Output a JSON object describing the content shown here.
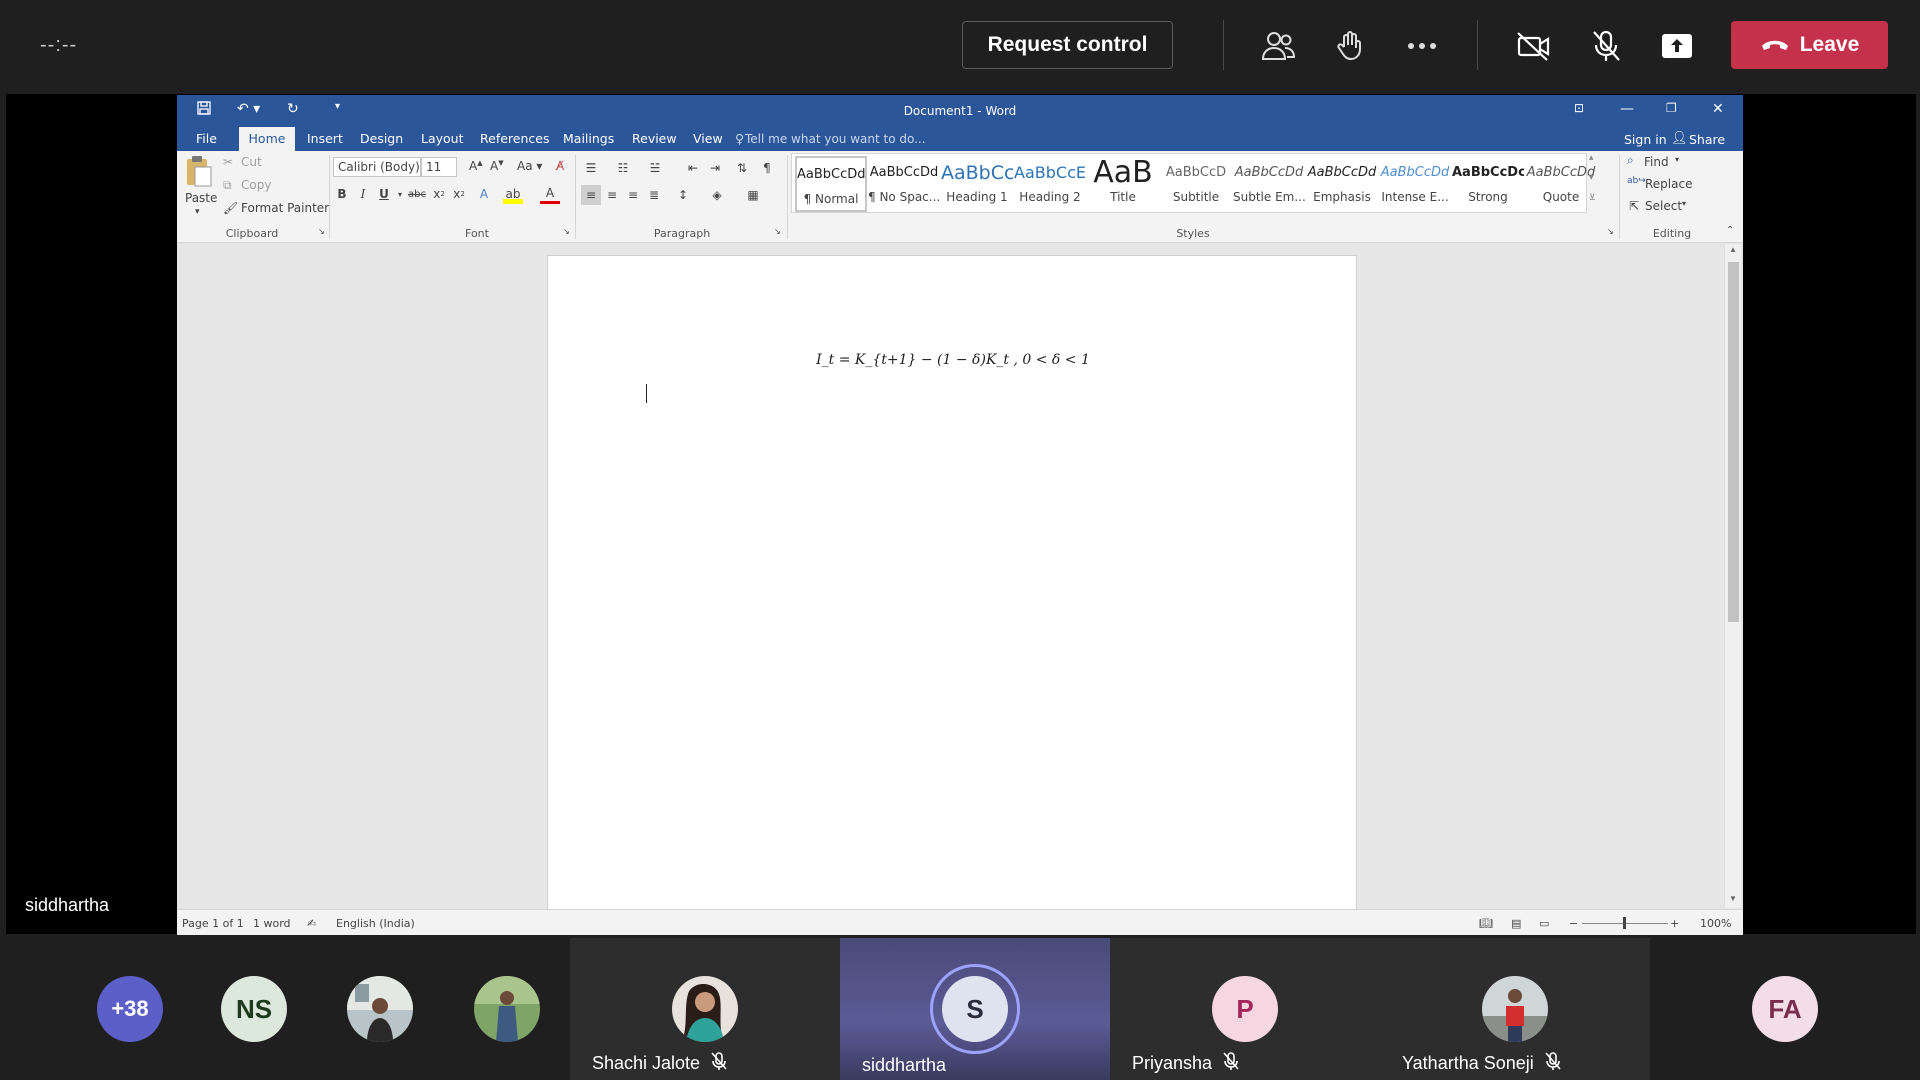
{
  "meeting": {
    "timer": "--:--",
    "request_control": "Request control",
    "leave": "Leave",
    "presenter_name": "siddhartha",
    "icons": [
      "people-icon",
      "raise-hand-icon",
      "more-options-icon",
      "camera-off-icon",
      "mic-off-icon",
      "share-screen-icon",
      "phone-hangup-icon"
    ],
    "leave_color": "#c4314b"
  },
  "word": {
    "title": "Document1 - Word",
    "menu": [
      "File",
      "Home",
      "Insert",
      "Design",
      "Layout",
      "References",
      "Mailings",
      "Review",
      "View"
    ],
    "active_tab": "Home",
    "tell_me": "Tell me what you want to do...",
    "sign_in": "Sign in",
    "share": "Share",
    "clipboard": {
      "paste": "Paste",
      "cut": "Cut",
      "copy": "Copy",
      "format_painter": "Format Painter",
      "label": "Clipboard"
    },
    "font": {
      "family": "Calibri (Body)",
      "size": "11",
      "label": "Font"
    },
    "paragraph": {
      "label": "Paragraph"
    },
    "styles": {
      "label": "Styles",
      "items": [
        {
          "preview": "AaBbCcDd",
          "name": "¶ Normal"
        },
        {
          "preview": "AaBbCcDd",
          "name": "¶ No Spac..."
        },
        {
          "preview": "AaBbCc",
          "name": "Heading 1"
        },
        {
          "preview": "AaBbCcE",
          "name": "Heading 2"
        },
        {
          "preview": "AaB",
          "name": "Title"
        },
        {
          "preview": "AaBbCcD",
          "name": "Subtitle"
        },
        {
          "preview": "AaBbCcDd",
          "name": "Subtle Em..."
        },
        {
          "preview": "AaBbCcDd",
          "name": "Emphasis"
        },
        {
          "preview": "AaBbCcDd",
          "name": "Intense E..."
        },
        {
          "preview": "AaBbCcDc",
          "name": "Strong"
        },
        {
          "preview": "AaBbCcDd",
          "name": "Quote"
        }
      ]
    },
    "editing": {
      "find": "Find",
      "replace": "Replace",
      "select": "Select",
      "label": "Editing"
    },
    "equation": "I_t = K_{t+1} − (1 − δ)K_t , 0 < δ < 1",
    "status": {
      "page": "Page 1 of 1",
      "words": "1 word",
      "language": "English (India)",
      "zoom": "100%"
    },
    "theme_color": "#2b579a"
  },
  "participants": {
    "overflow": "+38",
    "tiles": [
      {
        "initials": "NS",
        "name": ""
      },
      {
        "initials": "",
        "name": ""
      },
      {
        "initials": "",
        "name": ""
      },
      {
        "initials": "",
        "name": "Shachi Jalote",
        "muted": true
      },
      {
        "initials": "S",
        "name": "siddhartha",
        "muted": false
      },
      {
        "initials": "P",
        "name": "Priyansha",
        "muted": true
      },
      {
        "initials": "",
        "name": "Yathartha Soneji",
        "muted": true
      },
      {
        "initials": "FA",
        "name": ""
      }
    ]
  }
}
